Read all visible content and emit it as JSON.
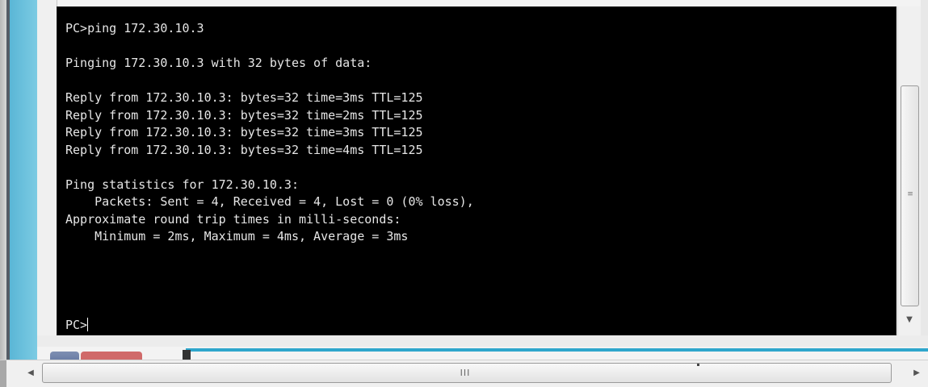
{
  "terminal": {
    "lines": [
      "PC>ping 172.30.10.3",
      "",
      "Pinging 172.30.10.3 with 32 bytes of data:",
      "",
      "Reply from 172.30.10.3: bytes=32 time=3ms TTL=125",
      "Reply from 172.30.10.3: bytes=32 time=2ms TTL=125",
      "Reply from 172.30.10.3: bytes=32 time=3ms TTL=125",
      "Reply from 172.30.10.3: bytes=32 time=4ms TTL=125",
      "",
      "Ping statistics for 172.30.10.3:",
      "    Packets: Sent = 4, Received = 4, Lost = 0 (0% loss),",
      "Approximate round trip times in milli-seconds:",
      "    Minimum = 2ms, Maximum = 4ms, Average = 3ms"
    ],
    "prompt": "PC>"
  },
  "scrollbars": {
    "vertical_grip": "≡",
    "vertical_down_arrow": "▼",
    "horizontal_left_arrow": "◀",
    "horizontal_grip": "III",
    "horizontal_right_arrow": "▶"
  },
  "colors": {
    "terminal_bg": "#000000",
    "terminal_fg": "#e6e6e6",
    "accent_blue": "#2fa6cc"
  }
}
